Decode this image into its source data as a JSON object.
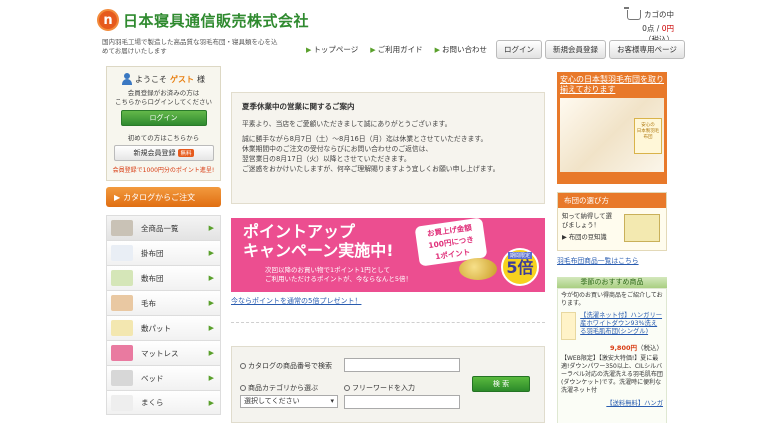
{
  "header": {
    "logo_mark": "n",
    "company": "日本寝具通信販売株式会社",
    "tagline": "国内羽毛工場で製造した高品質な羽毛布団・寝具類を心を込めてお届けいたします",
    "cart_label": "カゴの中",
    "cart_count": "0点",
    "cart_sep": " / ",
    "cart_price": "0円",
    "cart_tax": "（税込）"
  },
  "nav": {
    "links": [
      "トップページ",
      "ご利用ガイド",
      "お問い合わせ"
    ],
    "buttons": [
      "ログイン",
      "新規会員登録",
      "お客様専用ページ"
    ]
  },
  "sidebar": {
    "welcome_prefix": "ようこそ",
    "guest": "ゲスト",
    "welcome_suffix": "様",
    "guest_msg": "会員登録がお済みの方は\nこちらからログインしてください",
    "login_btn": "ログイン",
    "first_time": "初めての方はこちらから",
    "register_btn": "新規会員登録",
    "free_badge": "無料",
    "points_note": "会員登録で1000円分のポイント進呈!",
    "catalog_btn": "カタログからご注文",
    "categories": [
      {
        "label": "全商品一覧",
        "color": "#c9c2b6"
      },
      {
        "label": "掛布団",
        "color": "#e9eef5"
      },
      {
        "label": "敷布団",
        "color": "#d5e6b8"
      },
      {
        "label": "毛布",
        "color": "#e9c8a2"
      },
      {
        "label": "敷パット",
        "color": "#f3e7b0"
      },
      {
        "label": "マットレス",
        "color": "#e97aa0"
      },
      {
        "label": "ベッド",
        "color": "#d7d7d7"
      },
      {
        "label": "まくら",
        "color": "#eeeeee"
      }
    ]
  },
  "notice": {
    "title": "夏季休業中の営業に関するご案内",
    "line1": "平素より、当店をご愛顧いただきまして誠にありがとうございます。",
    "line2": "誠に勝手ながら8月7日（土）～8月16日（月）迄は休業とさせていただきます。",
    "line3": "休業期間中のご注文の受付ならびにお問い合わせのご返信は、",
    "line4": "翌営業日の8月17日（火）以降とさせていただきます。",
    "line5": "ご迷惑をおかけいたしますが、何卒ご理解賜りますよう宜しくお願い申し上げます。"
  },
  "banner": {
    "title1": "ポイントアップ",
    "title2": "キャンペーン実施中!",
    "badge": "お買上げ金額\n100円につき\n1ポイント",
    "limit": "期間限定",
    "multiplier": "5倍",
    "sub1": "次回以降のお買い物で1ポイント1円として",
    "sub2": "ご利用いただけるポイントが、今ならなんと5倍！",
    "link": "今ならポイントを通常の5倍プレゼント！"
  },
  "search": {
    "code_label": "カタログの商品番号で検索",
    "category_label": "商品カテゴリから選ぶ",
    "free_label": "フリーワードを入力",
    "select_value": "選択してください",
    "button": "検 索"
  },
  "right": {
    "feature_title": "安心の日本製羽毛布団を取り揃えております",
    "feature_card": "安心の\n日本製羽毛布団",
    "guide_head": "布団の選び方",
    "guide_text": "知って納得して選びましょう！",
    "guide_link": "布団の豆知識",
    "list_link": "羽毛布団商品一覧はこちら",
    "season_head": "季節のおすすめ商品",
    "season_msg": "今が旬のお買い得商品をご紹介しております。",
    "prod_name": "【洗濯ネット付】ハンガリー産ホワイトダウン93%洗える羽毛肌布団(シングル)",
    "prod_price": "9,800円",
    "prod_tax": "（税込）",
    "prod_desc": "【WEB限定】【激安大特価!】夏に最適!ダウンパワー350以上、CILシルバーラベル対応の洗濯洗える羽毛肌布団(ダウンケット)です。洗濯時に便利な洗濯ネット付",
    "prod2": "【送料無料】ハンガ"
  },
  "colors": {
    "brand_green": "#2f8a2f",
    "accent_orange": "#e8792a",
    "banner_pink": "#ec4e90"
  }
}
